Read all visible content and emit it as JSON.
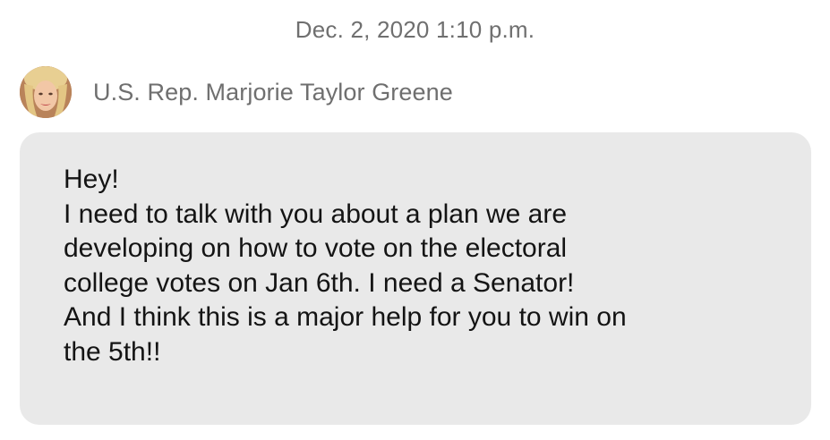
{
  "message": {
    "timestamp": "Dec. 2, 2020 1:10 p.m.",
    "sender": {
      "name": "U.S. Rep. Marjorie Taylor Greene",
      "avatar_icon": "profile-photo-avatar"
    },
    "lines": [
      "Hey!",
      "I need to talk with you about a plan we are",
      "developing on how to vote on the electoral",
      "college votes on Jan 6th. I need a Senator!",
      "And I think this is a major help for you to win on",
      "the 5th!!"
    ]
  },
  "colors": {
    "background": "#ffffff",
    "bubble": "#e9e9e9",
    "meta_text": "#6f6f6f",
    "message_text": "#141414"
  }
}
